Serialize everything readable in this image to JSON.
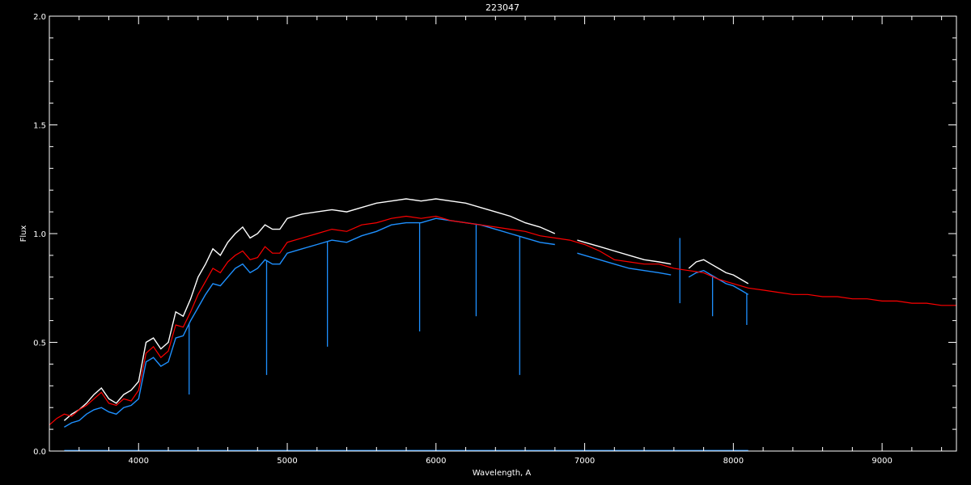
{
  "chart_data": {
    "type": "line",
    "title": "223047",
    "xlabel": "Wavelength, A",
    "ylabel": "Flux",
    "xlim": [
      3400,
      9500
    ],
    "ylim": [
      0.0,
      2.0
    ],
    "x_ticks": [
      4000,
      5000,
      6000,
      7000,
      8000,
      9000
    ],
    "x_tick_labels": [
      "4000",
      "5000",
      "6000",
      "7000",
      "8000",
      "9000"
    ],
    "y_ticks": [
      0.0,
      0.5,
      1.0,
      1.5,
      2.0
    ],
    "y_tick_labels": [
      "0.0",
      "0.5",
      "1.0",
      "1.5",
      "2.0"
    ],
    "grid": false,
    "background": "#000000",
    "series": [
      {
        "name": "",
        "color": "#ffffff",
        "segments": [
          {
            "x": [
              3500,
              3550,
              3600,
              3650,
              3700,
              3750,
              3800,
              3850,
              3900,
              3950,
              4000,
              4050,
              4100,
              4150,
              4200,
              4250,
              4300,
              4350,
              4400,
              4450,
              4500,
              4550,
              4600,
              4650,
              4700,
              4750,
              4800,
              4850,
              4900,
              4950,
              5000,
              5100,
              5200,
              5300,
              5400,
              5500,
              5600,
              5700,
              5800,
              5900,
              6000,
              6100,
              6200,
              6300,
              6400,
              6500,
              6600,
              6700,
              6800
            ],
            "y": [
              0.14,
              0.17,
              0.19,
              0.22,
              0.26,
              0.29,
              0.24,
              0.22,
              0.26,
              0.28,
              0.32,
              0.5,
              0.52,
              0.47,
              0.5,
              0.64,
              0.62,
              0.7,
              0.8,
              0.86,
              0.93,
              0.9,
              0.96,
              1.0,
              1.03,
              0.98,
              1.0,
              1.04,
              1.02,
              1.02,
              1.07,
              1.09,
              1.1,
              1.11,
              1.1,
              1.12,
              1.14,
              1.15,
              1.16,
              1.15,
              1.16,
              1.15,
              1.14,
              1.12,
              1.1,
              1.08,
              1.05,
              1.03,
              1.0
            ]
          },
          {
            "x": [
              6950,
              7000,
              7100,
              7200,
              7300,
              7400,
              7500,
              7580
            ],
            "y": [
              0.97,
              0.96,
              0.94,
              0.92,
              0.9,
              0.88,
              0.87,
              0.86
            ]
          },
          {
            "x": [
              7700,
              7750,
              7800,
              7850,
              7900,
              7950,
              8000,
              8050,
              8100
            ],
            "y": [
              0.84,
              0.87,
              0.88,
              0.86,
              0.84,
              0.82,
              0.81,
              0.79,
              0.77
            ]
          }
        ]
      },
      {
        "name": "",
        "color": "#1e90ff",
        "segments": [
          {
            "x": [
              3500,
              3550,
              3600,
              3650,
              3700,
              3750,
              3800,
              3850,
              3900,
              3950,
              4000,
              4050,
              4100,
              4150,
              4200,
              4250,
              4300,
              4350,
              4400,
              4450,
              4500,
              4550,
              4600,
              4650,
              4700,
              4750,
              4800,
              4850,
              4900,
              4950,
              5000,
              5100,
              5200,
              5300,
              5400,
              5500,
              5600,
              5700,
              5800,
              5900,
              6000,
              6100,
              6200,
              6300,
              6400,
              6500,
              6600,
              6700,
              6800
            ],
            "y": [
              0.11,
              0.13,
              0.14,
              0.17,
              0.19,
              0.2,
              0.18,
              0.17,
              0.2,
              0.21,
              0.24,
              0.41,
              0.43,
              0.39,
              0.41,
              0.52,
              0.53,
              0.6,
              0.66,
              0.72,
              0.77,
              0.76,
              0.8,
              0.84,
              0.86,
              0.82,
              0.84,
              0.88,
              0.86,
              0.86,
              0.91,
              0.93,
              0.95,
              0.97,
              0.96,
              0.99,
              1.01,
              1.04,
              1.05,
              1.05,
              1.07,
              1.06,
              1.05,
              1.04,
              1.02,
              1.0,
              0.98,
              0.96,
              0.95
            ]
          },
          {
            "x": [
              6950,
              7000,
              7100,
              7200,
              7300,
              7400,
              7500,
              7580
            ],
            "y": [
              0.91,
              0.9,
              0.88,
              0.86,
              0.84,
              0.83,
              0.82,
              0.81
            ]
          },
          {
            "x": [
              7700,
              7750,
              7800,
              7850,
              7900,
              7950,
              8000,
              8050,
              8100
            ],
            "y": [
              0.8,
              0.82,
              0.83,
              0.81,
              0.79,
              0.77,
              0.76,
              0.74,
              0.72
            ]
          }
        ],
        "absorption_lines": [
          {
            "x": 4861,
            "y": 0.35
          },
          {
            "x": 4340,
            "y": 0.26
          },
          {
            "x": 5270,
            "y": 0.48
          },
          {
            "x": 5890,
            "y": 0.55
          },
          {
            "x": 6270,
            "y": 0.62
          },
          {
            "x": 6563,
            "y": 0.35
          },
          {
            "x": 7640,
            "y": 0.68
          },
          {
            "x": 7860,
            "y": 0.62
          },
          {
            "x": 8090,
            "y": 0.58
          }
        ]
      },
      {
        "name": "",
        "color": "#ff0000",
        "x": [
          3400,
          3450,
          3500,
          3550,
          3600,
          3650,
          3700,
          3750,
          3800,
          3850,
          3900,
          3950,
          4000,
          4050,
          4100,
          4150,
          4200,
          4250,
          4300,
          4350,
          4400,
          4450,
          4500,
          4550,
          4600,
          4650,
          4700,
          4750,
          4800,
          4850,
          4900,
          4950,
          5000,
          5100,
          5200,
          5300,
          5400,
          5500,
          5600,
          5700,
          5800,
          5900,
          6000,
          6100,
          6200,
          6300,
          6400,
          6500,
          6600,
          6700,
          6800,
          6900,
          7000,
          7100,
          7200,
          7300,
          7400,
          7500,
          7600,
          7700,
          7800,
          7900,
          8000,
          8100,
          8200,
          8300,
          8400,
          8500,
          8600,
          8700,
          8800,
          8900,
          9000,
          9100,
          9200,
          9300,
          9400,
          9500
        ],
        "y": [
          0.12,
          0.15,
          0.17,
          0.16,
          0.19,
          0.21,
          0.24,
          0.27,
          0.22,
          0.21,
          0.24,
          0.23,
          0.28,
          0.45,
          0.48,
          0.43,
          0.46,
          0.58,
          0.57,
          0.64,
          0.72,
          0.78,
          0.84,
          0.82,
          0.87,
          0.9,
          0.92,
          0.88,
          0.89,
          0.94,
          0.91,
          0.91,
          0.96,
          0.98,
          1.0,
          1.02,
          1.01,
          1.04,
          1.05,
          1.07,
          1.08,
          1.07,
          1.08,
          1.06,
          1.05,
          1.04,
          1.03,
          1.02,
          1.01,
          0.99,
          0.98,
          0.97,
          0.95,
          0.92,
          0.88,
          0.87,
          0.86,
          0.86,
          0.84,
          0.83,
          0.82,
          0.79,
          0.77,
          0.75,
          0.74,
          0.73,
          0.72,
          0.72,
          0.71,
          0.71,
          0.7,
          0.7,
          0.69,
          0.69,
          0.68,
          0.68,
          0.67,
          0.67
        ]
      },
      {
        "name": "",
        "color": "#1e90ff",
        "x": [
          3500,
          6800,
          6950,
          7580,
          7700,
          8100
        ],
        "y": [
          0.003,
          0.003,
          0.003,
          0.003,
          0.003,
          0.003
        ]
      }
    ]
  }
}
